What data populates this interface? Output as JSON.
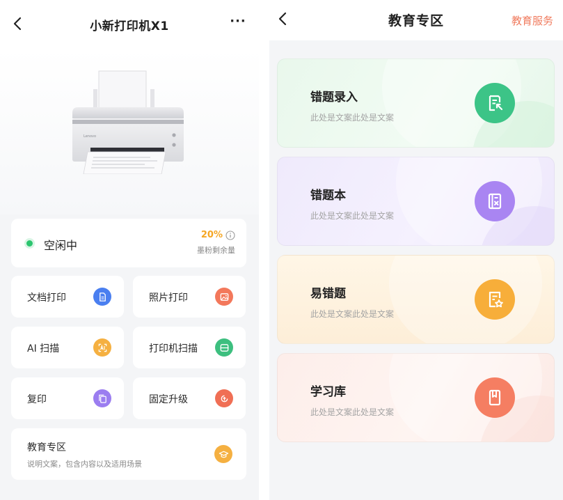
{
  "left": {
    "header": {
      "title": "小新打印机X1",
      "more": "···"
    },
    "status": {
      "text": "空闲中",
      "ink_percent": "20%",
      "ink_label": "墨粉剩余量",
      "ink_level": 0.2
    },
    "tiles": [
      {
        "label": "文档打印",
        "icon": "document-icon",
        "color": "#4a7ff0"
      },
      {
        "label": "照片打印",
        "icon": "image-icon",
        "color": "#f3785b"
      },
      {
        "label": "AI 扫描",
        "icon": "ai-scan-icon",
        "color": "#f5b041"
      },
      {
        "label": "打印机扫描",
        "icon": "scanner-icon",
        "color": "#3dbf7f"
      },
      {
        "label": "复印",
        "icon": "copy-icon",
        "color": "#9b7df0"
      },
      {
        "label": "固定升级",
        "icon": "upgrade-icon",
        "color": "#f06f55"
      }
    ],
    "education": {
      "title": "教育专区",
      "desc": "说明文案，包含内容以及适用场景",
      "icon": "graduation-cap-icon",
      "color": "#f5b041"
    }
  },
  "right": {
    "header": {
      "title": "教育专区",
      "service": "教育服务",
      "service_color": "#f07b5e"
    },
    "cards": [
      {
        "title": "错题录入",
        "desc": "此处是文案此处是文案",
        "icon": "edit-document-icon",
        "color": "#3cc487"
      },
      {
        "title": "错题本",
        "desc": "此处是文案此处是文案",
        "icon": "notebook-icon",
        "color": "#a985f2"
      },
      {
        "title": "易错题",
        "desc": "此处是文案此处是文案",
        "icon": "starred-document-icon",
        "color": "#f7ae3a"
      },
      {
        "title": "学习库",
        "desc": "此处是文案此处是文案",
        "icon": "book-icon",
        "color": "#f57e62"
      }
    ]
  }
}
